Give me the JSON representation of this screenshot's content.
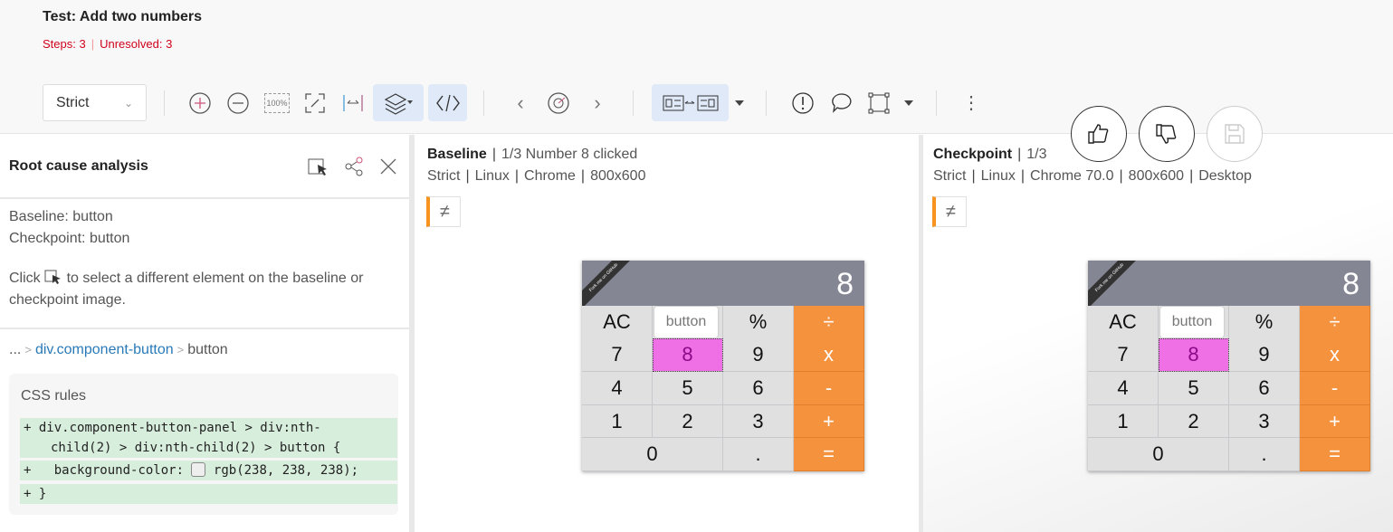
{
  "header": {
    "title": "Test: Add two numbers",
    "steps": "Steps: 3",
    "unresolved": "Unresolved: 3"
  },
  "toolbar": {
    "match_level": "Strict",
    "zoom_100": "100%"
  },
  "accent": {
    "orange": "#f7931e",
    "diff_green": "#d8eedd",
    "highlight": "#ef6fe4"
  },
  "rca": {
    "title": "Root cause analysis",
    "baseline": "Baseline: button",
    "checkpoint": "Checkpoint: button",
    "hint_pre": "Click",
    "hint_post": "to select a different element on the baseline or checkpoint image.",
    "crumb": {
      "ellipsis": "...",
      "parent": "div.component-button",
      "current": "button"
    },
    "css_title": "CSS rules",
    "diff": [
      {
        "sign": "+",
        "line1": "div.component-button-panel > div:nth-",
        "line2": "child(2) > div:nth-child(2) > button {"
      },
      {
        "sign": "+",
        "prop": "background-color:",
        "value": "rgb(238, 238, 238);"
      },
      {
        "sign": "+",
        "text": "}"
      }
    ]
  },
  "baseline": {
    "label": "Baseline",
    "step": "1/3 Number 8 clicked",
    "meta": [
      "Strict",
      "Linux",
      "Chrome",
      "800x600"
    ]
  },
  "checkpoint": {
    "label": "Checkpoint",
    "step": "1/3",
    "meta": [
      "Strict",
      "Linux",
      "Chrome 70.0",
      "800x600",
      "Desktop"
    ]
  },
  "diff_symbol": "≠",
  "calculator": {
    "display": "8",
    "ribbon": "Fork me on GitHub",
    "tooltip": "button",
    "keys": [
      [
        "AC",
        "+/-",
        "%",
        "÷"
      ],
      [
        "7",
        "8",
        "9",
        "x"
      ],
      [
        "4",
        "5",
        "6",
        "-"
      ],
      [
        "1",
        "2",
        "3",
        "+"
      ],
      [
        "0",
        ".",
        "="
      ]
    ],
    "highlighted": "8"
  }
}
